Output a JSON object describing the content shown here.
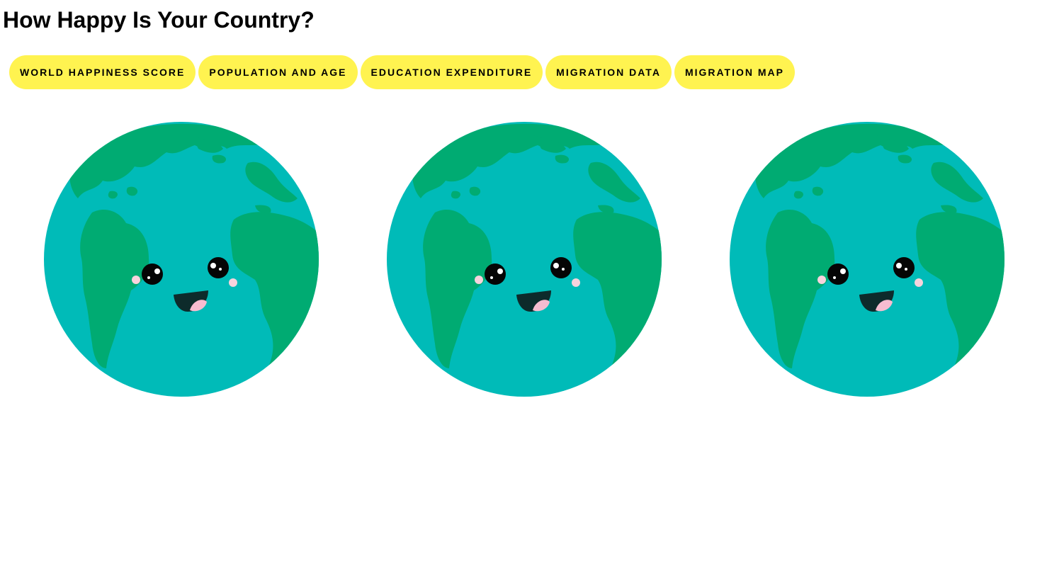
{
  "page": {
    "title": "How Happy Is Your Country?"
  },
  "nav": {
    "items": [
      {
        "label": "WORLD HAPPINESS SCORE"
      },
      {
        "label": "POPULATION AND AGE"
      },
      {
        "label": "EDUCATION EXPENDITURE"
      },
      {
        "label": "MIGRATION DATA"
      },
      {
        "label": "MIGRATION MAP"
      }
    ]
  },
  "globes": [
    {
      "icon": "happy-earth-icon"
    },
    {
      "icon": "happy-earth-icon"
    },
    {
      "icon": "happy-earth-icon"
    }
  ],
  "colors": {
    "button_bg": "#fff350",
    "ocean": "#00bbb8",
    "land": "#00ab72",
    "eye": "#050505",
    "mouth": "#0d2b2b",
    "tongue": "#f6bcd0",
    "cheek": "#f7d3dd"
  }
}
